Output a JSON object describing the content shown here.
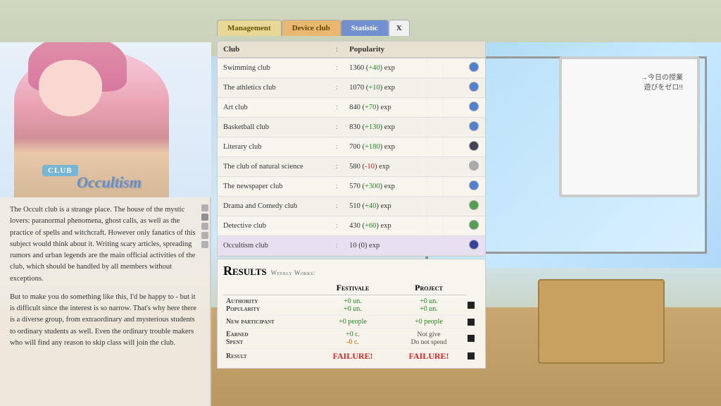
{
  "background": {
    "type": "classroom"
  },
  "tabs": {
    "management": "Management",
    "device_club": "Device club",
    "statistic": "Statistic",
    "close": "X"
  },
  "left_panel": {
    "club_badge": "CLUB",
    "club_name": "Occultism",
    "description_p1": "The Occult club is a strange place. The house of the mystic lovers: paranormal phenomena, ghost calls, as well as the practice of spells and witchcraft. However only fanatics of this subject would think about it. Writing scary articles, spreading rumors and urban legends are the main official activities of the club, which should be handled by all members without exceptions.",
    "description_p2": "But to make you do something like this, I'd be happy to - but it is difficult since the interest is so narrow. That's why here there is a diverse group, from extraordinary and mysterious students to ordinary students as well. Even the ordinary trouble makers who will find any reason to skip class will join the club."
  },
  "club_table": {
    "headers": {
      "club": "Club",
      "colon": ":",
      "popularity": "Popularity"
    },
    "rows": [
      {
        "name": "Swimming club",
        "popularity": "1360",
        "change": "+40",
        "positive": true
      },
      {
        "name": "The athletics club",
        "popularity": "1070",
        "change": "+10",
        "positive": true
      },
      {
        "name": "Art club",
        "popularity": "840",
        "change": "+70",
        "positive": true
      },
      {
        "name": "Basketball club",
        "popularity": "830",
        "change": "+130",
        "positive": true
      },
      {
        "name": "Literary club",
        "popularity": "700",
        "change": "+180",
        "positive": true
      },
      {
        "name": "The club of natural science",
        "popularity": "580",
        "change": "-10",
        "positive": false
      },
      {
        "name": "The newspaper club",
        "popularity": "570",
        "change": "+300",
        "positive": true
      },
      {
        "name": "Drama and Comedy club",
        "popularity": "510",
        "change": "+40",
        "positive": true
      },
      {
        "name": "Detective club",
        "popularity": "430",
        "change": "+60",
        "positive": true
      },
      {
        "name": "Occultism club",
        "popularity": "10",
        "change": "0",
        "positive": null
      }
    ]
  },
  "results": {
    "title": "Results",
    "subtitle": "Weekly Works:",
    "col_festivale": "Festivale",
    "col_project": "Project",
    "rows": [
      {
        "label": "Authority\nPopularity",
        "festivale_1": "+0 un.",
        "festivale_2": "+0 un.",
        "project_1": "+0 un.",
        "project_2": "+0 un."
      },
      {
        "label": "New participant",
        "festivale": "+0 people",
        "project": "+0 people"
      },
      {
        "label": "Earned\nSpent",
        "festivale_1": "+0 c.",
        "festivale_2": "-0 c.",
        "project_1": "Not give",
        "project_2": "Do not spend"
      },
      {
        "label": "Result",
        "festivale": "FAILURE!",
        "project": "FAILURE!"
      }
    ]
  }
}
